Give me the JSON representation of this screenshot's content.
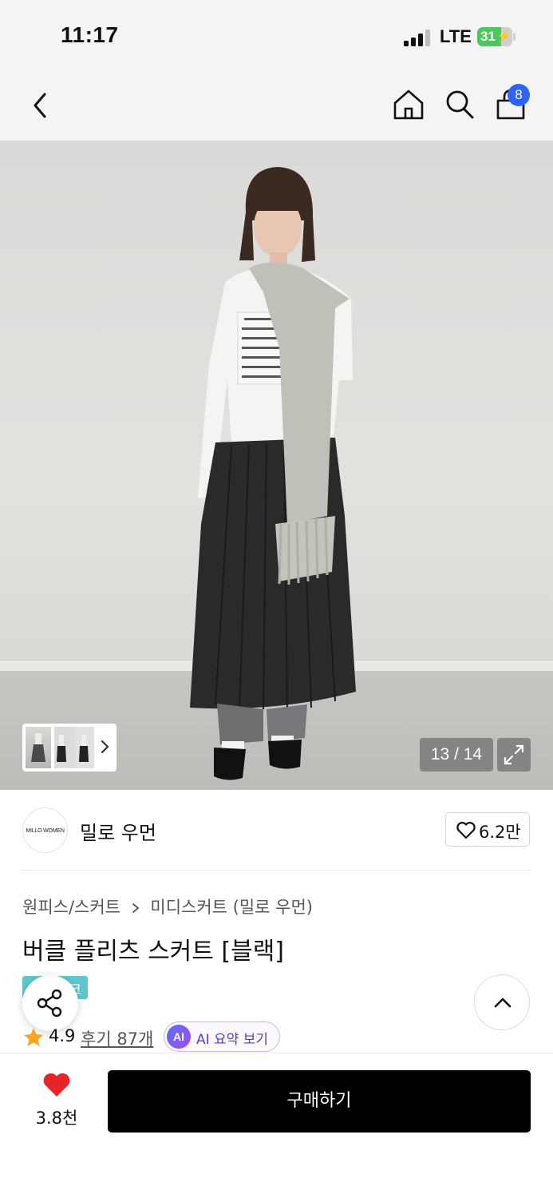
{
  "status_bar": {
    "time": "11:17",
    "network": "LTE",
    "battery": "31"
  },
  "nav": {
    "cart_badge": "8",
    "icons": [
      "back-icon",
      "home-icon",
      "search-icon",
      "cart-icon"
    ]
  },
  "gallery": {
    "counter": "13 / 14"
  },
  "brand": {
    "logo_text": "MILLO WOMEN",
    "name": "밀로 우먼",
    "like_count": "6.2만"
  },
  "product": {
    "breadcrumb_category": "원피스/스커트",
    "breadcrumb_sub": "미디스커트 (밀로 우먼)",
    "title": "버클 플리츠 스커트 [블랙]",
    "tag_partial": "크",
    "rating": "4.9",
    "review_label": "후기 87개",
    "ai_badge": "AI",
    "ai_summary_label": "AI 요약 보기"
  },
  "bottom_bar": {
    "wish_count": "3.8천",
    "buy_label": "구매하기"
  },
  "colors": {
    "accent_blue": "#2f63f5",
    "heart_red": "#e8242b",
    "star_orange": "#f5a623",
    "tag_teal": "#5fc6ce",
    "ai_purple": "#5a3ec8"
  }
}
